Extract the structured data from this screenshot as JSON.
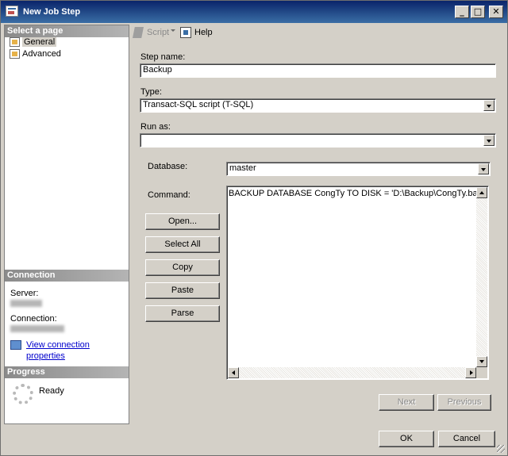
{
  "window": {
    "title": "New Job Step"
  },
  "sidebar": {
    "select_page_header": "Select a page",
    "items": [
      {
        "label": "General",
        "selected": true
      },
      {
        "label": "Advanced",
        "selected": false
      }
    ]
  },
  "connection": {
    "header": "Connection",
    "server_label": "Server:",
    "connection_label": "Connection:",
    "view_link": "View connection properties"
  },
  "progress": {
    "header": "Progress",
    "status": "Ready"
  },
  "toolbar": {
    "script_label": "Script",
    "help_label": "Help"
  },
  "form": {
    "step_name_label": "Step name:",
    "step_name_value": "Backup",
    "type_label": "Type:",
    "type_value": "Transact-SQL script (T-SQL)",
    "run_as_label": "Run as:",
    "run_as_value": "",
    "database_label": "Database:",
    "database_value": "master",
    "command_label": "Command:",
    "command_text": "BACKUP DATABASE CongTy TO DISK = 'D:\\Backup\\CongTy.bak'"
  },
  "command_buttons": {
    "open": "Open...",
    "select_all": "Select All",
    "copy": "Copy",
    "paste": "Paste",
    "parse": "Parse"
  },
  "nav_buttons": {
    "next": "Next",
    "previous": "Previous"
  },
  "dialog_buttons": {
    "ok": "OK",
    "cancel": "Cancel"
  }
}
